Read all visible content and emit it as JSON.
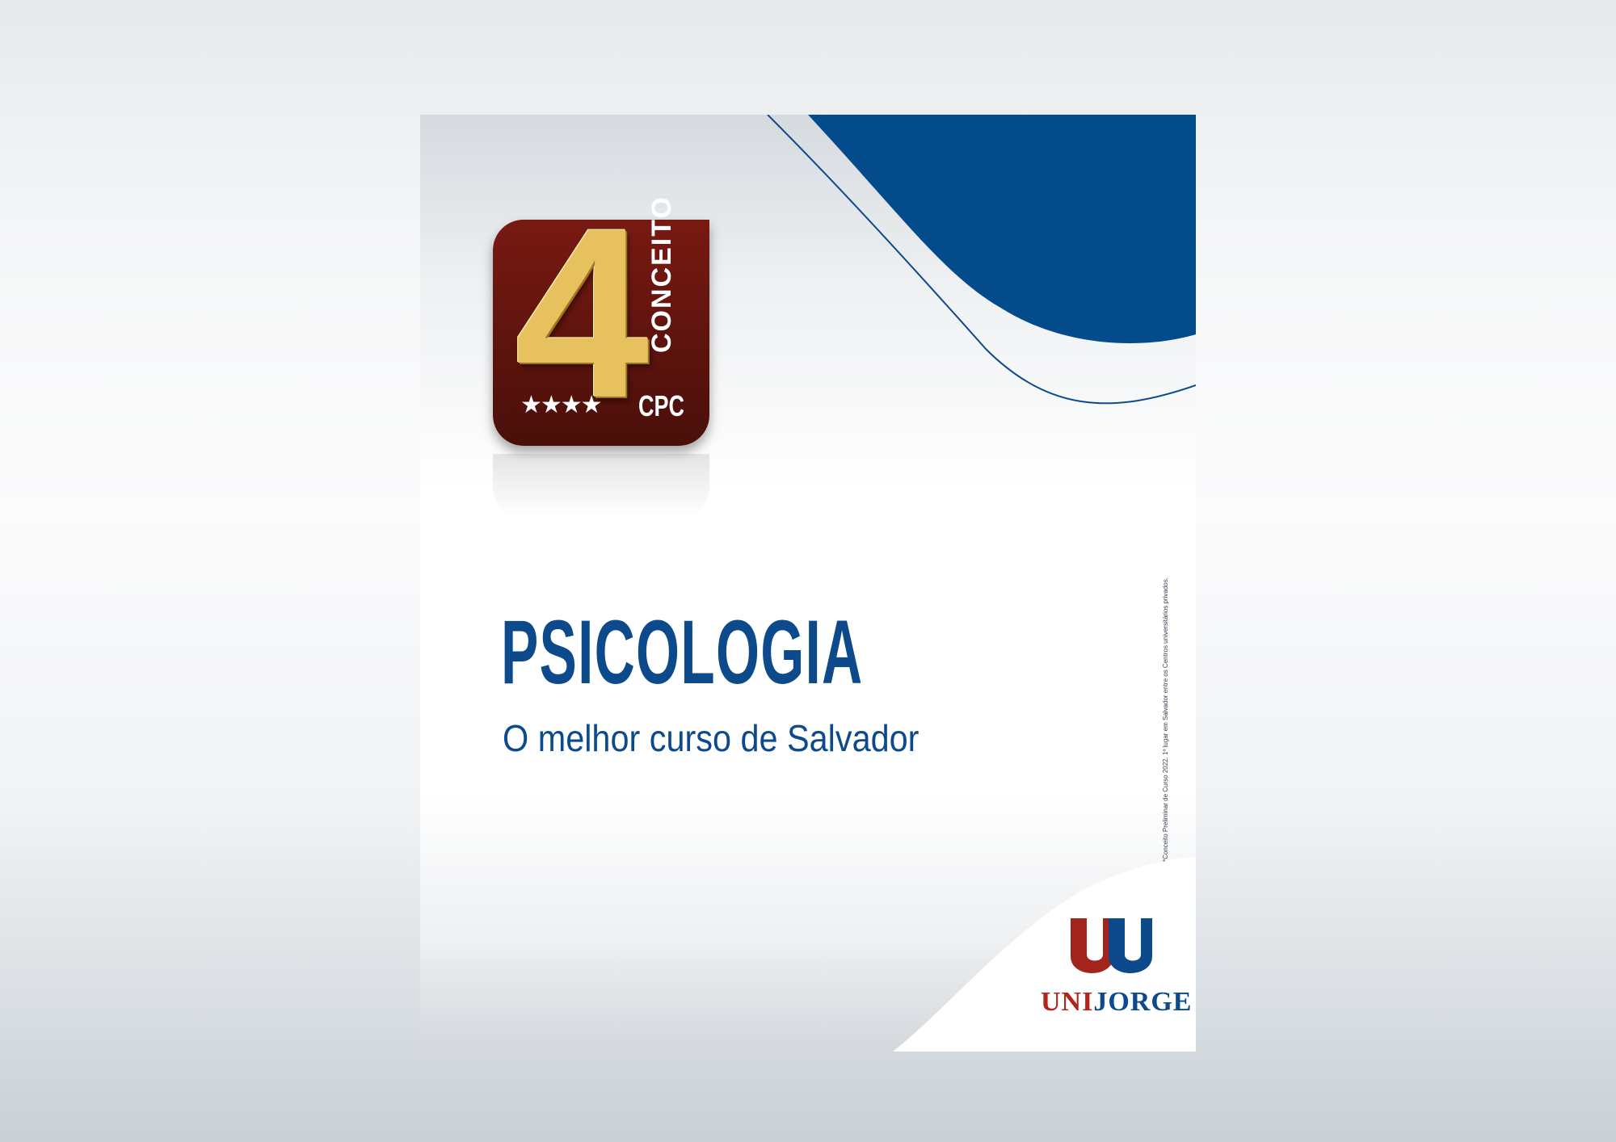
{
  "poster": {
    "course_title": "PSICOLOGIA",
    "tagline": "O melhor curso de Salvador",
    "footnote": "*Conceito Preliminar de Curso 2022. 1º lugar em Salvador entre os Centros universitários privados."
  },
  "badge": {
    "number": "4",
    "word": "CONCEITO",
    "acronym": "CPC",
    "stars": "★★★★",
    "stars_rating": 4
  },
  "logo": {
    "uni": "UNI",
    "jorge": "JORGE"
  },
  "colors": {
    "brand_blue": "#0d4a8c",
    "badge_maroon": "#6b160f",
    "badge_gold": "#e6c15e",
    "logo_red": "#b3241d"
  }
}
